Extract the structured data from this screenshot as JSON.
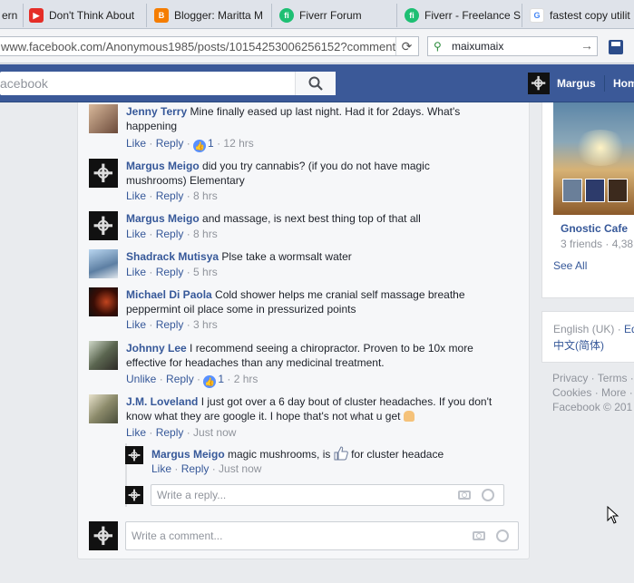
{
  "browser": {
    "tabs": [
      {
        "label": "ern",
        "icon": "",
        "color": ""
      },
      {
        "label": "Don't Think About",
        "icon": "youtube-icon",
        "color": "#e52d27"
      },
      {
        "label": "Blogger: Maritta M",
        "icon": "blogger-icon",
        "color": "#f57d00"
      },
      {
        "label": "Fiverr Forum",
        "icon": "fiverr-icon",
        "color": "#1dbf73"
      },
      {
        "label": "Fiverr - Freelance S",
        "icon": "fiverr-icon",
        "color": "#1dbf73"
      },
      {
        "label": "fastest copy utilit",
        "icon": "google-icon",
        "color": "#4285f4"
      }
    ],
    "url": "www.facebook.com/Anonymous1985/posts/10154253006256152?comment_id",
    "search_value": "maixumaix"
  },
  "fb_header": {
    "search_placeholder": "acebook",
    "user_name": "Margus",
    "home_label": "Hom"
  },
  "comments": [
    {
      "name": "Jenny Terry",
      "text": "Mine finally eased up last night. Had it for 2days. What's happening",
      "like": "Like",
      "reply": "Reply",
      "likes": "1",
      "time": "12 hrs"
    },
    {
      "name": "Margus Meigo",
      "text": "did you try cannabis? (if you do not have magic mushrooms) Elementary",
      "like": "Like",
      "reply": "Reply",
      "time": "8 hrs"
    },
    {
      "name": "Margus Meigo",
      "text": "and massage, is next best thing top of that all",
      "like": "Like",
      "reply": "Reply",
      "time": "8 hrs"
    },
    {
      "name": "Shadrack Mutisya",
      "text": "Plse take a wormsalt water",
      "like": "Like",
      "reply": "Reply",
      "time": "5 hrs"
    },
    {
      "name": "Michael Di Paola",
      "text": "Cold shower helps me cranial self massage breathe peppermint oil place some in pressurized points",
      "like": "Like",
      "reply": "Reply",
      "time": "3 hrs"
    },
    {
      "name": "Johnny Lee",
      "text": "I recommend seeing a chiropractor. Proven to be 10x more effective for headaches than any medicinal treatment.",
      "like": "Unlike",
      "reply": "Reply",
      "likes": "1",
      "time": "2 hrs"
    },
    {
      "name": "J.M. Loveland",
      "text": "I just got over a 6 day bout of cluster headaches. If you don't know what they are google it. I hope that's not what u get",
      "like": "Like",
      "reply": "Reply",
      "time": "Just now"
    }
  ],
  "reply": {
    "name": "Margus Meigo",
    "text_before": "magic mushrooms, is",
    "text_after": "for cluster headace",
    "like": "Like",
    "reply": "Reply",
    "time": "Just now"
  },
  "reply_input_placeholder": "Write a reply...",
  "comment_input_placeholder": "Write a comment...",
  "sidebar": {
    "page_title": "Gnostic Cafe",
    "page_sub": "3 friends · 4,38",
    "see_all": "See All",
    "lang_current": "English (UK) ·",
    "lang_link": "Ed",
    "lang_chinese": "中文(简体)",
    "footer_line1": "Privacy · Terms ·",
    "footer_line2": "Cookies · More ·",
    "footer_line3": "Facebook © 201"
  },
  "colors": {
    "fb_blue": "#3b5998",
    "link": "#365899",
    "meta": "#90949c"
  }
}
